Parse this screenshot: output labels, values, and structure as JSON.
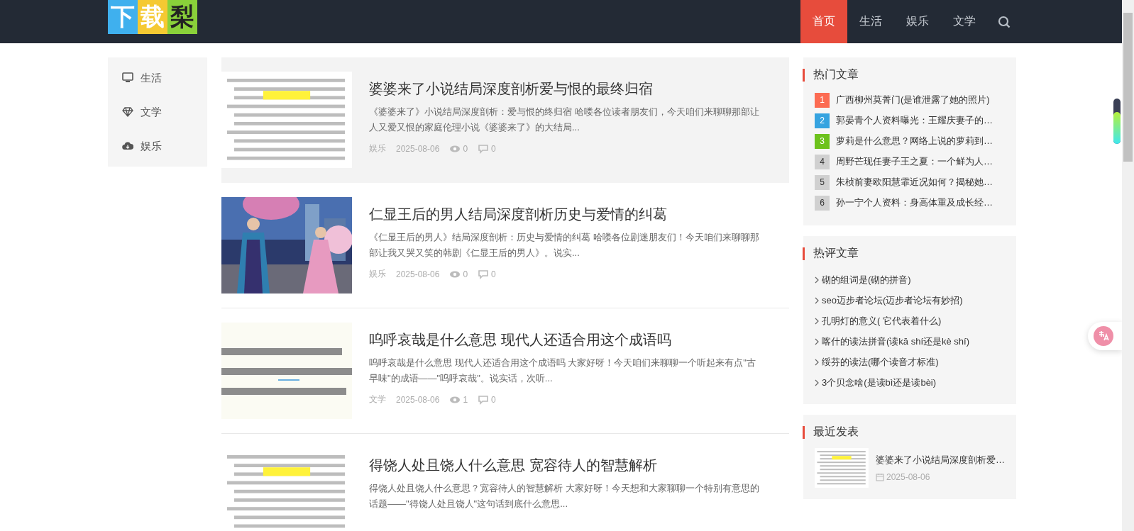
{
  "logo": {
    "tiles": [
      "下",
      "载",
      "梨"
    ]
  },
  "nav": [
    {
      "label": "首页",
      "selected": true
    },
    {
      "label": "生活",
      "selected": false
    },
    {
      "label": "娱乐",
      "selected": false
    },
    {
      "label": "文学",
      "selected": false
    }
  ],
  "sidebar": {
    "items": [
      {
        "label": "生活",
        "kind": "monitor"
      },
      {
        "label": "文学",
        "kind": "diamond"
      },
      {
        "label": "娱乐",
        "kind": "cloud"
      }
    ]
  },
  "articles": [
    {
      "title": "婆婆来了小说结局深度剖析爱与恨的最终归宿",
      "excerpt": "《婆婆来了》小说结局深度剖析：爱与恨的终归宿 哈喽各位读者朋友们，今天咱们来聊聊那部让人又爱又恨的家庭伦理小说《婆婆来了》的大结局...",
      "category": "娱乐",
      "date": "2025-08-06",
      "views": "0",
      "comments": "0",
      "highlighted": true,
      "thumb": {
        "kind": "text-page"
      }
    },
    {
      "title": "仁显王后的男人结局深度剖析历史与爱情的纠葛",
      "excerpt": "《仁显王后的男人》结局深度剖析：历史与爱情的纠葛 哈喽各位剧迷朋友们！今天咱们来聊聊那部让我又哭又笑的韩剧《仁显王后的男人》。说实...",
      "category": "娱乐",
      "date": "2025-08-06",
      "views": "0",
      "comments": "0",
      "highlighted": false,
      "thumb": {
        "kind": "poster"
      }
    },
    {
      "title": "呜呼哀哉是什么意思 现代人还适合用这个成语吗",
      "excerpt": "呜呼哀哉是什么意思 现代人还适合用这个成语吗 大家好呀！今天咱们来聊聊一个听起来有点\"古早味\"的成语——\"呜呼哀哉\"。说实话，次听...",
      "category": "文学",
      "date": "2025-08-06",
      "views": "1",
      "comments": "0",
      "highlighted": false,
      "thumb": {
        "kind": "text-banner"
      }
    },
    {
      "title": "得饶人处且饶人什么意思 宽容待人的智慧解析",
      "excerpt": "得饶人处且饶人什么意思？宽容待人的智慧解析 大家好呀！今天想和大家聊聊一个特别有意思的话题——\"得饶人处且饶人\"这句话到底什么意思...",
      "highlighted": false,
      "thumb": {
        "kind": "text-page"
      }
    }
  ],
  "hot_articles": {
    "title": "热门文章",
    "items": [
      {
        "rank": "1",
        "color": "#fc6b52",
        "title": "广西柳州莫菁门(是谁泄露了她的照片)"
      },
      {
        "rank": "2",
        "color": "#36a3e0",
        "title": "郭晏青个人资料曝光：王耀庆妻子的…"
      },
      {
        "rank": "3",
        "color": "#6dc21c",
        "title": "萝莉是什么意思？网络上说的萝莉到…"
      },
      {
        "rank": "4",
        "color": "#d0d0d0",
        "title": "周野芒现任妻子王之夏：一个鲜为人…"
      },
      {
        "rank": "5",
        "color": "#d0d0d0",
        "title": "朱桢前妻欧阳慧霏近况如何？揭秘她…"
      },
      {
        "rank": "6",
        "color": "#d0d0d0",
        "title": "孙一宁个人资料：身高体重及成长经…"
      }
    ]
  },
  "hot_comments": {
    "title": "热评文章",
    "items": [
      "砌的组词是(砌的拼音)",
      "seo迈步者论坛(迈步者论坛有妙招)",
      "孔明灯的意义( 它代表着什么)",
      "喀什的读法拼音(读kā shí还是kè shí)",
      "绥芬的读法(哪个读音才标准)",
      "3个贝念啥(是读bì还是读bèi)"
    ]
  },
  "recent": {
    "title": "最近发表",
    "items": [
      {
        "title": "婆婆来了小说结局深度剖析爱…",
        "date": "2025-08-06",
        "thumb": {
          "kind": "text-page"
        }
      }
    ]
  }
}
